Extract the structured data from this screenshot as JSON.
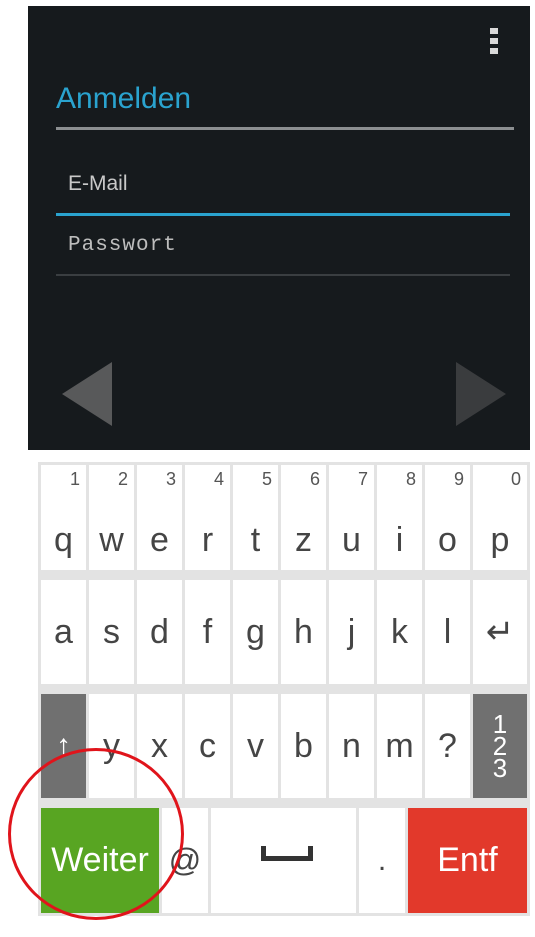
{
  "app": {
    "title": "Anmelden",
    "email_placeholder": "E-Mail",
    "password_placeholder": "Passwort"
  },
  "keyboard": {
    "row1": [
      {
        "num": "1",
        "ch": "q"
      },
      {
        "num": "2",
        "ch": "w"
      },
      {
        "num": "3",
        "ch": "e"
      },
      {
        "num": "4",
        "ch": "r"
      },
      {
        "num": "5",
        "ch": "t"
      },
      {
        "num": "6",
        "ch": "z"
      },
      {
        "num": "7",
        "ch": "u"
      },
      {
        "num": "8",
        "ch": "i"
      },
      {
        "num": "9",
        "ch": "o"
      },
      {
        "num": "0",
        "ch": "p"
      }
    ],
    "row2": [
      "a",
      "s",
      "d",
      "f",
      "g",
      "h",
      "j",
      "k",
      "l",
      "↵"
    ],
    "row3": [
      "↑",
      "y",
      "x",
      "c",
      "v",
      "b",
      "n",
      "m",
      "?"
    ],
    "num_key": [
      "1",
      "2",
      "3"
    ],
    "weiter": "Weiter",
    "at": "@",
    "dot": ".",
    "entf": "Entf"
  },
  "colors": {
    "accent": "#2aa3cf",
    "weiter_bg": "#58a522",
    "entf_bg": "#e2392b",
    "annotation_circle": "#e0141b"
  }
}
